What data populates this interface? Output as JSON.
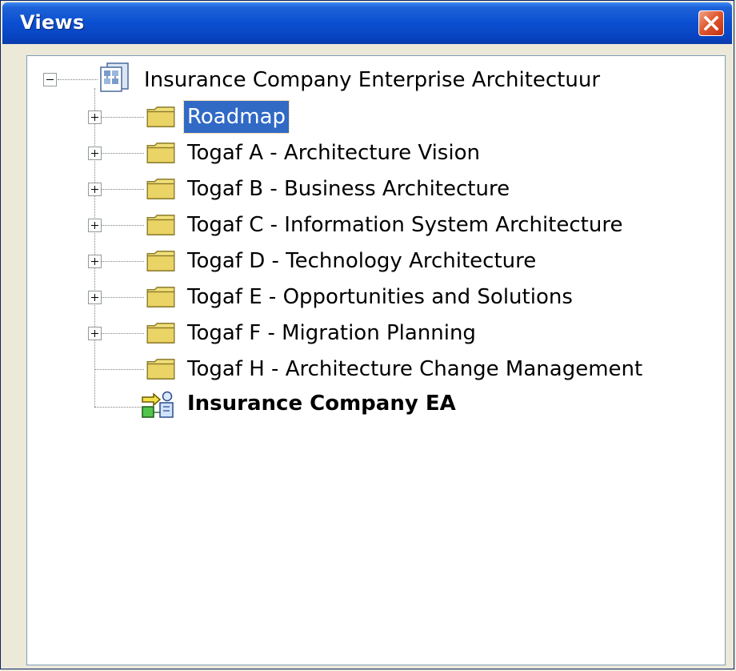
{
  "window": {
    "title": "Views",
    "close_icon": "close-icon"
  },
  "tree": {
    "root": {
      "label": "Insurance Company Enterprise Architectuur",
      "icon": "model-icon",
      "expanded": true
    },
    "folders": [
      {
        "label": "Roadmap",
        "selected": true
      },
      {
        "label": "Togaf A - Architecture Vision"
      },
      {
        "label": "Togaf B - Business Architecture"
      },
      {
        "label": "Togaf C - Information System Architecture"
      },
      {
        "label": "Togaf D - Technology Architecture"
      },
      {
        "label": "Togaf E - Opportunities and Solutions"
      },
      {
        "label": "Togaf F - Migration Planning"
      },
      {
        "label": "Togaf H - Architecture Change Management",
        "no_expander": true
      }
    ],
    "view": {
      "label": "Insurance Company EA",
      "icon": "architecture-view-icon"
    }
  },
  "colors": {
    "titlebar": "#0a4fd0",
    "selection": "#316ac5",
    "folder": "#f1df7a",
    "window_bg": "#ece9d8"
  }
}
